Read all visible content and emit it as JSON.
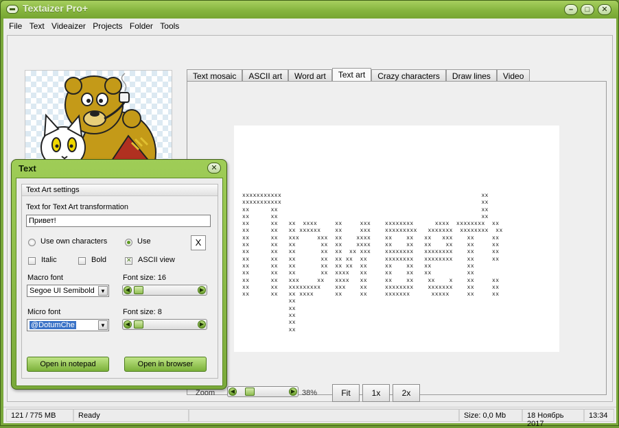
{
  "window": {
    "title": "Textaizer Pro+"
  },
  "menu": [
    "File",
    "Text",
    "Videaizer",
    "Projects",
    "Folder",
    "Tools"
  ],
  "tabs": [
    {
      "label": "Text mosaic",
      "active": false
    },
    {
      "label": "ASCII art",
      "active": false
    },
    {
      "label": "Word art",
      "active": false
    },
    {
      "label": "Text art",
      "active": true
    },
    {
      "label": "Crazy characters",
      "active": false
    },
    {
      "label": "Draw lines",
      "active": false
    },
    {
      "label": "Video",
      "active": false
    }
  ],
  "art_text": "xxxxxxxxxxx                                                        xx\nxxxxxxxxxxx                                                        xx\nxx      xx                                                         xx\nxx      xx                                                         xx\nxx      xx   xx  xxxx     xx     xxx    xxxxxxxx      xxxx  xxxxxxxx  xx\nxx      xx   xx xxxxxx    xx     xxx    xxxxxxxxx   xxxxxxx  xxxxxxxx  xx\nxx      xx   xxx     xxx  xx    xxxx    xx    xx   xx   xxx    xx     xx\nxx      xx   xx       xx  xx    xxxx    xx    xx   xx    xx    xx     xx\nxx      xx   xx       xx  xx  xx xxx    xxxxxxxx   xxxxxxxx    xx     xx\nxx      xx   xx       xx  xx xx  xx     xxxxxxxx   xxxxxxxx    xx     xx\nxx      xx   xx       xx  xx xx  xx     xx    xx   xx          xx\nxx      xx   xx       xx  xxxx   xx     xx    xx   xx          xx\nxx      xx   xxx     xx   xxxx   xx     xx    xx    xx    x    xx     xx\nxx      xx   xxxxxxxxx    xxx    xx     xxxxxxxx    xxxxxxx    xx     xx\nxx      xx   xx xxxx      xx     xx     xxxxxxx      xxxxx     xx     xx\n             xx\n             xx\n             xx\n             xx\n             xx",
  "zoom": {
    "label": "Zoom",
    "value": "38%",
    "level": 0.38,
    "buttons": [
      "Fit",
      "1x",
      "2x"
    ]
  },
  "status": {
    "memory": "121 / 775 MB",
    "state": "Ready",
    "size": "Size: 0,0 Mb",
    "date": "18 Ноябрь 2017",
    "time": "13:34"
  },
  "dialog": {
    "title": "Text",
    "group_title": "Text Art settings",
    "text_label": "Text for Text Art transformation",
    "text_value": "Привет!",
    "radio_own": "Use own characters",
    "radio_use": "Use",
    "char_value": "X",
    "italic": "Italic",
    "bold": "Bold",
    "ascii_view": "ASCII view",
    "macro_font_label": "Macro font",
    "macro_font_value": "Segoe UI Semibold",
    "macro_size_label": "Font size: 16",
    "micro_font_label": "Micro font",
    "micro_font_value": "@DotumChe",
    "micro_size_label": "Font size: 8",
    "open_notepad": "Open in notepad",
    "open_browser": "Open in browser"
  },
  "colors": {
    "frame": "#7aa83b",
    "accent": "#8fbd52",
    "selection": "#3b73c7"
  }
}
